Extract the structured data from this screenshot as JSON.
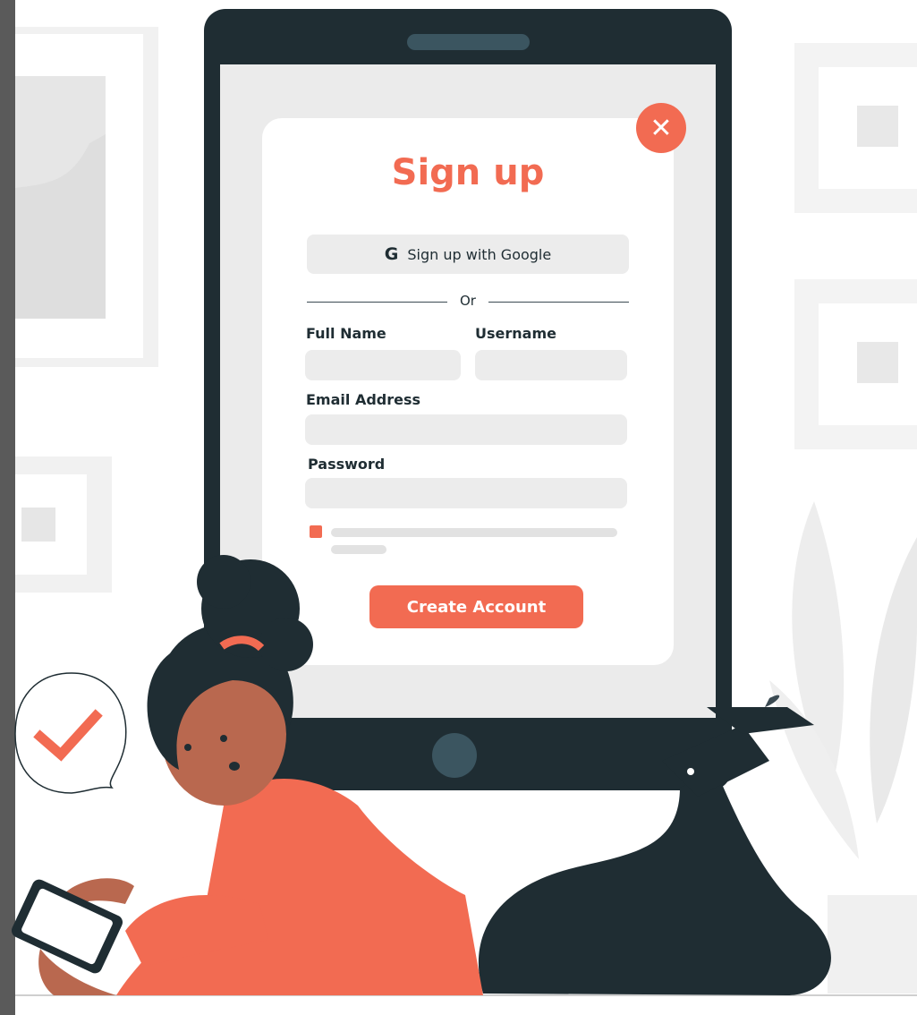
{
  "signup": {
    "title": "Sign up",
    "google_label": "Sign up with Google",
    "google_glyph": "G",
    "or_label": "Or",
    "full_name_label": "Full Name",
    "username_label": "Username",
    "email_label": "Email Address",
    "password_label": "Password",
    "create_label": "Create Account",
    "close_glyph": "✕"
  },
  "colors": {
    "accent": "#f26b52",
    "tablet": "#1f2d33",
    "field": "#ececec"
  }
}
